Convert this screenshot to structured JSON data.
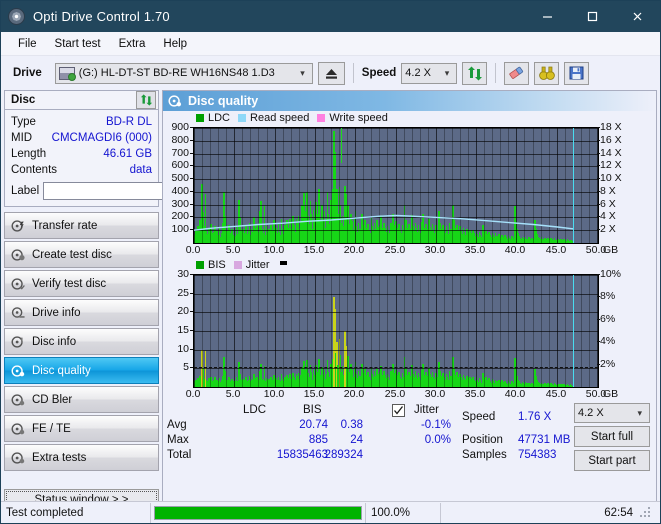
{
  "window": {
    "title": "Opti Drive Control 1.70",
    "icon": "disc-icon",
    "minimize": "minimize-icon",
    "maximize": "maximize-icon",
    "close": "close-icon"
  },
  "menu": {
    "items": [
      {
        "label": "File",
        "accel": "F"
      },
      {
        "label": "Start test",
        "accel": "S"
      },
      {
        "label": "Extra",
        "accel": "x"
      },
      {
        "label": "Help",
        "accel": "H"
      }
    ]
  },
  "toolbar": {
    "drive_label": "Drive",
    "drive_value": "(G:)  HL-DT-ST BD-RE  WH16NS48 1.D3",
    "eject_icon": "eject-icon",
    "speed_label": "Speed",
    "speed_value": "4.2 X",
    "refresh_icon": "refresh-icon",
    "eraser_icon": "eraser-icon",
    "binocular_icon": "binoculars-icon",
    "save_icon": "save-floppy-icon"
  },
  "disc": {
    "header": "Disc",
    "refresh_icon": "refresh-icon",
    "rows": [
      {
        "key": "Type",
        "value": "BD-R DL"
      },
      {
        "key": "MID",
        "value": "CMCMAGDI6 (000)"
      },
      {
        "key": "Length",
        "value": "46.61 GB"
      },
      {
        "key": "Contents",
        "value": "data"
      }
    ],
    "label_key": "Label",
    "label_value": "",
    "label_placeholder": "",
    "label_button_icon": "disc-icon"
  },
  "nav": {
    "items": [
      {
        "label": "Transfer rate",
        "icon": "disc-speed-icon",
        "active": false
      },
      {
        "label": "Create test disc",
        "icon": "disc-write-icon",
        "active": false
      },
      {
        "label": "Verify test disc",
        "icon": "disc-verify-icon",
        "active": false
      },
      {
        "label": "Drive info",
        "icon": "drive-info-icon",
        "active": false
      },
      {
        "label": "Disc info",
        "icon": "disc-info-icon",
        "active": false
      },
      {
        "label": "Disc quality",
        "icon": "disc-quality-icon",
        "active": true
      },
      {
        "label": "CD Bler",
        "icon": "disc-bler-icon",
        "active": false
      },
      {
        "label": "FE / TE",
        "icon": "disc-fete-icon",
        "active": false
      },
      {
        "label": "Extra tests",
        "icon": "disc-extra-icon",
        "active": false
      }
    ],
    "status_window": "Status window > >"
  },
  "content": {
    "title": "Disc quality",
    "title_icon": "disc-quality-icon"
  },
  "chart_data": [
    {
      "type": "area",
      "name": "ldc-chart",
      "title": "",
      "xlabel": "GB",
      "ylabel": "",
      "legend": [
        {
          "label": "LDC",
          "color": "#00a000"
        },
        {
          "label": "Read speed",
          "color": "#8ed8f8"
        },
        {
          "label": "Write speed",
          "color": "#ff80e0"
        }
      ],
      "legend_position": "top-left",
      "grid": true,
      "x": [
        0.0,
        5.0,
        10.0,
        15.0,
        20.0,
        25.0,
        30.0,
        35.0,
        40.0,
        45.0,
        50.0
      ],
      "xlim": [
        0.0,
        50.0
      ],
      "xticks": [
        "0.0",
        "5.0",
        "10.0",
        "15.0",
        "20.0",
        "25.0",
        "30.0",
        "35.0",
        "40.0",
        "45.0",
        "50.0"
      ],
      "ylim": [
        0,
        900
      ],
      "yticks": [
        "100",
        "200",
        "300",
        "400",
        "500",
        "600",
        "700",
        "800",
        "900"
      ],
      "y2lim": [
        0,
        18
      ],
      "y2ticks": [
        "2 X",
        "4 X",
        "6 X",
        "8 X",
        "10 X",
        "12 X",
        "14 X",
        "16 X",
        "18 X"
      ],
      "series": [
        {
          "name": "LDC",
          "color": "#17d617",
          "values": [
            60,
            110,
            95,
            130,
            70,
            180,
            95,
            460,
            240,
            130,
            380,
            95,
            70,
            110,
            60,
            150,
            75,
            55,
            90,
            130,
            70,
            95,
            60,
            120,
            50,
            80,
            160,
            400,
            210,
            70,
            95,
            60,
            140,
            75,
            50,
            110,
            65,
            90,
            55,
            130,
            70,
            340,
            200,
            95,
            60,
            110,
            80,
            50,
            140,
            70,
            95,
            160,
            60,
            110,
            85,
            200,
            120,
            60,
            150,
            90,
            70,
            250,
            330,
            110,
            80,
            300,
            60,
            130,
            90,
            110,
            70,
            140,
            95,
            60,
            180,
            100,
            120,
            80,
            150,
            90,
            60,
            185,
            110,
            70,
            140,
            95,
            180,
            120,
            60,
            190,
            110,
            80,
            210,
            140,
            90,
            185,
            160,
            210,
            110,
            170,
            300,
            180,
            390,
            250,
            130,
            400,
            210,
            150,
            330,
            230,
            110,
            260,
            180,
            320,
            150,
            230,
            420,
            180,
            110,
            300,
            170,
            250,
            120,
            190,
            400,
            230,
            150,
            340,
            210,
            420,
            880,
            710,
            340,
            420,
            230,
            440,
            300,
            160,
            210,
            130,
            450,
            380,
            180,
            300,
            150,
            120,
            230,
            170,
            100,
            190,
            250,
            130,
            90,
            160,
            110,
            80,
            230,
            140,
            100,
            180,
            120,
            90,
            150,
            105,
            75,
            195,
            130,
            95,
            160,
            110,
            180,
            125,
            90,
            145,
            210,
            120,
            85,
            160,
            115,
            90,
            130,
            100,
            75,
            160,
            110,
            230,
            140,
            95,
            175,
            120,
            85,
            150,
            105,
            80,
            140,
            100,
            300,
            180,
            120,
            90,
            150,
            110,
            85,
            220,
            130,
            95,
            160,
            115,
            85,
            140,
            100,
            75,
            165,
            230,
            120,
            90,
            150,
            110,
            80,
            185,
            125,
            95,
            150,
            105,
            80,
            140,
            100,
            75,
            250,
            160,
            110,
            85,
            140,
            100,
            75,
            130,
            95,
            70,
            155,
            110,
            85,
            300,
            180,
            120,
            90,
            145,
            100,
            75,
            130,
            95,
            70,
            120,
            90,
            65,
            110,
            85,
            60,
            105,
            80,
            60,
            100,
            75,
            55,
            95,
            70,
            50,
            90,
            65,
            45,
            140,
            85,
            60,
            95,
            70,
            50,
            85,
            60,
            45,
            80,
            60,
            45,
            75,
            55,
            40,
            70,
            50,
            38,
            65,
            48,
            35,
            60,
            45,
            33,
            58,
            42,
            30,
            55,
            40,
            28,
            290,
            170,
            110,
            75,
            55,
            40,
            30,
            50,
            38,
            28,
            48,
            35,
            26,
            45,
            33,
            25,
            43,
            32,
            24,
            180,
            110,
            70,
            50,
            38,
            28,
            45,
            33,
            25,
            42,
            30,
            23,
            40,
            29,
            22,
            38,
            28,
            21,
            36,
            26,
            20,
            34,
            25,
            19,
            32,
            24,
            18,
            30,
            22,
            17,
            28,
            21,
            16,
            26,
            20,
            15
          ]
        }
      ],
      "read_speed": {
        "name": "Read speed",
        "color": "#a6e2fb",
        "unit": "X",
        "points": [
          [
            0,
            2.0
          ],
          [
            2,
            2.3
          ],
          [
            5,
            2.6
          ],
          [
            8,
            2.9
          ],
          [
            11,
            3.1
          ],
          [
            14,
            3.4
          ],
          [
            17,
            3.6
          ],
          [
            20,
            3.9
          ],
          [
            23,
            4.2
          ],
          [
            25,
            4.3
          ],
          [
            27,
            4.2
          ],
          [
            30,
            4.0
          ],
          [
            33,
            3.8
          ],
          [
            36,
            3.5
          ],
          [
            39,
            3.2
          ],
          [
            42,
            2.9
          ],
          [
            45,
            2.5
          ],
          [
            47,
            2.2
          ]
        ]
      },
      "cursor_green_gb": 18.2,
      "cursor_cyan_gb": 46.9
    },
    {
      "type": "area",
      "name": "bis-chart",
      "title": "",
      "xlabel": "GB",
      "ylabel": "",
      "legend": [
        {
          "label": "BIS",
          "color": "#00a000"
        },
        {
          "label": "Jitter",
          "color": "#d8a8e0"
        }
      ],
      "legend_position": "top-left",
      "grid": true,
      "xlim": [
        0.0,
        50.0
      ],
      "xticks": [
        "0.0",
        "5.0",
        "10.0",
        "15.0",
        "20.0",
        "25.0",
        "30.0",
        "35.0",
        "40.0",
        "45.0",
        "50.0"
      ],
      "ylim": [
        0,
        30
      ],
      "yticks": [
        "5",
        "10",
        "15",
        "20",
        "25",
        "30"
      ],
      "y2lim": [
        0,
        10
      ],
      "y2ticks": [
        "2%",
        "4%",
        "6%",
        "8%",
        "10%"
      ],
      "series": [
        {
          "name": "BIS",
          "color": "#17d617",
          "values": [
            1.5,
            2.0,
            1.6,
            2.4,
            1.8,
            3.0,
            2.0,
            10.0,
            5.0,
            2.2,
            9.6,
            2.0,
            1.6,
            2.4,
            1.5,
            2.8,
            1.7,
            1.5,
            2.0,
            2.6,
            1.6,
            2.0,
            1.5,
            2.4,
            1.4,
            1.8,
            3.0,
            8.0,
            4.2,
            1.6,
            2.0,
            1.5,
            2.6,
            1.7,
            1.4,
            2.2,
            1.6,
            2.0,
            1.5,
            2.6,
            1.6,
            6.6,
            3.6,
            2.0,
            1.5,
            2.2,
            1.8,
            1.4,
            2.6,
            1.6,
            2.0,
            3.0,
            1.5,
            2.2,
            1.8,
            3.6,
            2.4,
            1.5,
            2.8,
            1.9,
            1.6,
            4.4,
            6.2,
            2.2,
            1.8,
            5.6,
            1.5,
            2.4,
            1.9,
            2.2,
            1.6,
            2.6,
            2.0,
            1.5,
            3.2,
            2.0,
            2.4,
            1.8,
            2.8,
            1.9,
            1.5,
            3.4,
            2.2,
            1.6,
            2.6,
            2.0,
            3.2,
            2.4,
            1.5,
            3.4,
            2.2,
            1.8,
            3.8,
            2.6,
            1.9,
            3.4,
            2.9,
            3.8,
            2.2,
            3.1,
            5.4,
            3.2,
            7.0,
            4.5,
            2.4,
            7.2,
            3.8,
            2.7,
            5.9,
            4.1,
            2.0,
            4.7,
            3.2,
            5.8,
            2.7,
            4.1,
            7.6,
            3.2,
            2.0,
            5.4,
            3.1,
            4.5,
            2.2,
            3.4,
            7.2,
            4.1,
            2.7,
            6.1,
            3.8,
            7.6,
            24.0,
            21.0,
            9.0,
            12.0,
            6.0,
            13.0,
            8.5,
            4.0,
            5.6,
            3.2,
            15.0,
            11.0,
            5.0,
            8.2,
            4.0,
            3.2,
            6.2,
            4.5,
            2.7,
            5.1,
            6.7,
            3.4,
            2.4,
            4.3,
            2.9,
            2.1,
            6.2,
            3.8,
            2.7,
            4.9,
            3.2,
            2.4,
            4.1,
            2.8,
            2.0,
            5.3,
            3.5,
            2.6,
            4.3,
            3.0,
            4.9,
            3.4,
            2.4,
            3.9,
            5.7,
            3.2,
            2.3,
            4.3,
            3.1,
            2.4,
            3.5,
            2.7,
            2.0,
            4.3,
            3.0,
            6.2,
            3.8,
            2.6,
            4.7,
            3.2,
            2.3,
            4.1,
            2.8,
            2.2,
            3.8,
            2.7,
            8.1,
            4.9,
            3.2,
            2.4,
            4.1,
            3.0,
            2.3,
            5.9,
            3.5,
            2.6,
            4.3,
            3.1,
            2.3,
            3.8,
            2.7,
            2.0,
            4.5,
            6.2,
            3.2,
            2.4,
            4.1,
            3.0,
            2.2,
            5.0,
            3.4,
            2.6,
            4.1,
            2.8,
            2.2,
            3.8,
            2.7,
            2.0,
            6.7,
            4.3,
            3.0,
            2.3,
            3.8,
            2.7,
            2.0,
            3.5,
            2.6,
            1.9,
            4.2,
            3.0,
            2.3,
            8.1,
            4.9,
            3.2,
            2.4,
            3.9,
            2.7,
            2.0,
            3.5,
            2.6,
            1.9,
            3.2,
            2.4,
            1.8,
            3.0,
            2.3,
            1.6,
            2.8,
            2.2,
            1.6,
            2.7,
            2.0,
            1.5,
            2.6,
            1.9,
            1.4,
            2.4,
            1.8,
            1.2,
            3.8,
            2.3,
            1.6,
            2.6,
            1.9,
            1.4,
            2.3,
            1.6,
            1.2,
            2.2,
            1.6,
            1.2,
            2.0,
            1.5,
            1.1,
            1.9,
            1.4,
            1.0,
            1.8,
            1.3,
            1.0,
            1.6,
            1.2,
            0.9,
            1.6,
            1.1,
            0.8,
            1.5,
            1.1,
            0.8,
            7.8,
            4.6,
            3.0,
            2.0,
            1.5,
            1.1,
            0.8,
            1.4,
            1.0,
            0.8,
            1.3,
            1.0,
            0.7,
            1.2,
            0.9,
            0.7,
            1.2,
            0.9,
            0.7,
            4.9,
            3.0,
            1.9,
            1.4,
            1.0,
            0.8,
            1.2,
            0.9,
            0.7,
            1.1,
            0.8,
            0.6,
            1.1,
            0.8,
            0.6,
            1.0,
            0.8,
            0.6,
            1.0,
            0.7,
            0.5,
            0.9,
            0.7,
            0.5,
            0.9,
            0.7,
            0.5,
            0.8,
            0.6,
            0.5,
            0.8,
            0.6,
            0.4,
            0.7,
            0.5,
            0.4
          ]
        }
      ],
      "cursor_cyan_gb": 46.9,
      "dash_level_pct": 1.75,
      "legend_marker": "black-rect-marker"
    }
  ],
  "stats": {
    "col_headers": [
      "LDC",
      "BIS"
    ],
    "rows": [
      {
        "label": "Avg",
        "ldc": "20.74",
        "bis": "0.38",
        "jitter": "-0.1%"
      },
      {
        "label": "Max",
        "ldc": "885",
        "bis": "24",
        "jitter": "0.0%"
      },
      {
        "label": "Total",
        "ldc": "15835463",
        "bis": "289324",
        "jitter": ""
      }
    ],
    "jitter_label": "Jitter",
    "jitter_checked": true,
    "speed_label": "Speed",
    "speed_value": "1.76 X",
    "position_label": "Position",
    "position_value": "47731 MB",
    "samples_label": "Samples",
    "samples_value": "754383",
    "speed_select": "4.2 X",
    "start_full": "Start full",
    "start_part": "Start part"
  },
  "statusbar": {
    "message": "Test completed",
    "progress_pct": "100.0%",
    "progress_value": 100,
    "elapsed": "62:54"
  },
  "colors": {
    "accent": "#17a6e8",
    "title_bar": "#22465c",
    "value_text": "#1414d0",
    "plot_bg": "#5c6a87",
    "ldc_green": "#17d617",
    "read_speed": "#a6e2fb",
    "write_speed": "#ff80e0",
    "cursor_cyan": "#49dcf0",
    "progress_green": "#00b300"
  }
}
